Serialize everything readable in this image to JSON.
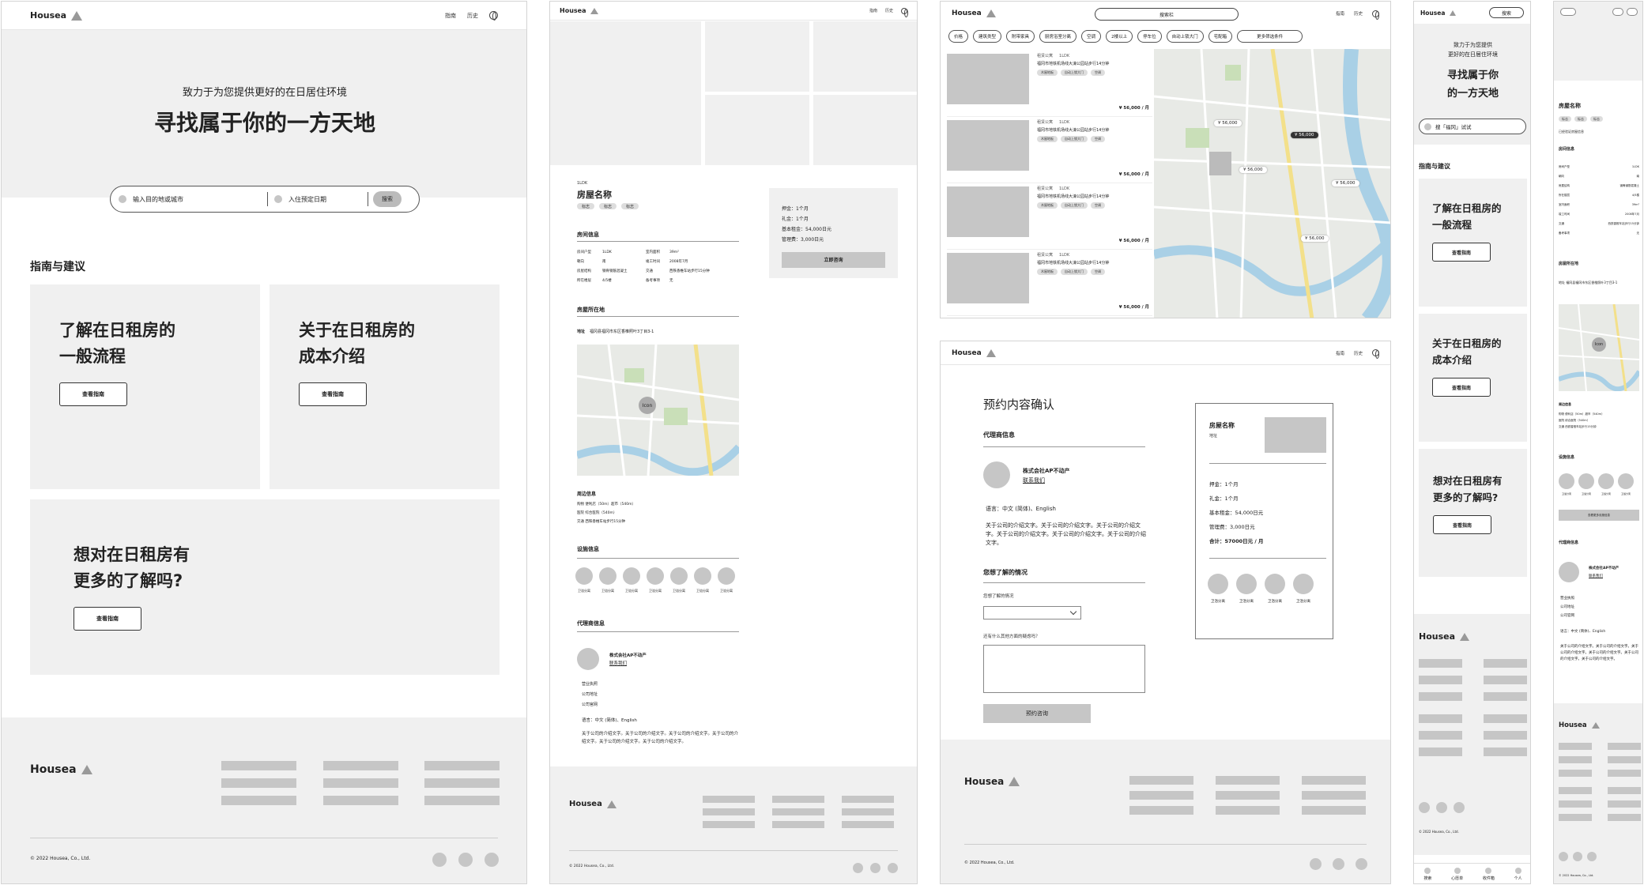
{
  "brand": "Housea",
  "nav": {
    "guide": "指南",
    "history": "历史"
  },
  "home": {
    "subtitle": "致力于为您提供更好的在日居住环境",
    "title": "寻找属于你的一方天地",
    "search_dest": "输入目的地或城市",
    "search_date": "入住预定日期",
    "search_btn": "搜索",
    "section": "指南与建议",
    "card1_l1": "了解在日租房的",
    "card1_l2": "一般流程",
    "card2_l1": "关于在日租房的",
    "card2_l2": "成本介绍",
    "card3_l1": "想对在日租房有",
    "card3_l2": "更多的了解吗?",
    "card_btn": "查看指南"
  },
  "copyright": "© 2022 Housea, Co., Ltd.",
  "detail": {
    "tag": "1LDK",
    "name": "房屋名称",
    "chip": "标志",
    "room_info": "房间信息",
    "rows": [
      [
        "房间户型",
        "1LDK",
        "室内面积",
        "39m²"
      ],
      [
        "朝向",
        "南",
        "竣工时间",
        "2008年7月"
      ],
      [
        "房屋结构",
        "钢骨钢筋混凝土",
        "交通",
        "西铁香椎车站步行15分钟"
      ],
      [
        "所在楼层",
        "4/5楼",
        "备考事项",
        "无"
      ]
    ],
    "location": "房屋所在地",
    "addr_label": "地址",
    "addr": "福冈县福冈市东区香椎照叶3丁目3-1",
    "map_icon": "Icon",
    "nearby": "周边信息",
    "nearby_rows": [
      "购物  便利店（50m）超市（540m）",
      "医院  综合医院（540m）",
      "交通  西铁香椎车站步行15分钟"
    ],
    "facilities": "设施信息",
    "fac_label": "卫浴分离",
    "agent_sec": "代理商信息",
    "agent": "株式会社AP不动产",
    "contact": "联系我们",
    "agent_items": [
      "营业执照",
      "公司地址",
      "公司官网"
    ],
    "lang": "语言：中文 (简体)、English",
    "intro": "关于公司的介绍文字。关于公司的介绍文字。关于公司的介绍文字。关于公司的介绍文字。关于公司的介绍文字。关于公司的介绍文字。",
    "price": [
      "押金：1个月",
      "礼金：1个月",
      "基本租金：54,000日元",
      "管理费：3,000日元"
    ],
    "consult_btn": "立即咨询"
  },
  "search": {
    "placeholder": "搜索栏",
    "filters": [
      "价格",
      "建筑类型",
      "附带家具",
      "厨房浴室分离",
      "空调",
      "2楼以上",
      "停车位",
      "自动上锁大门",
      "宅配箱",
      "更多筛选条件"
    ],
    "listing_type": "租赁公寓",
    "listing_layout": "1LDK",
    "listing_addr": "福冈市地铁机场线大濠公园站步行14分钟",
    "listing_tags": [
      "木屋地板",
      "自动上锁大门",
      "空调"
    ],
    "listing_price": "¥ 56,000 / 月",
    "pins": [
      "¥ 56,000",
      "¥ 56,000",
      "¥ 56,000",
      "¥ 56,000",
      "¥ 56,000"
    ]
  },
  "confirm": {
    "title": "预约内容确认",
    "agent_sec": "代理商信息",
    "want_sec": "您想了解的情况",
    "want_label": "您想了解的情况",
    "other_label": "还有什么其他方面的疑虑吗？",
    "submit": "预约咨询",
    "room": "房屋名称",
    "addr": "地址",
    "price": [
      "押金：1个月",
      "礼金：1个月",
      "基本租金：54,000日元",
      "管理费：3,000日元"
    ],
    "total": "合计：57000日元 / 月"
  },
  "mobile": {
    "search_btn": "搜索",
    "subtitle1": "致力于为您提供",
    "subtitle2": "更好的在日居住环境",
    "title1": "寻找属于你",
    "title2": "的一方天地",
    "search_ph": "搜「福冈」试试",
    "section": "指南与建议",
    "tabs": [
      "搜索",
      "心愿单",
      "收件箱",
      "个人"
    ]
  },
  "mdetail": {
    "room_info": "房间信息",
    "rows": [
      [
        "房间户型",
        "1LDK"
      ],
      [
        "朝向",
        "南"
      ],
      [
        "房屋结构",
        "钢骨钢筋混凝土"
      ],
      [
        "所在楼层",
        "4/5楼"
      ],
      [
        "室内面积",
        "39m²"
      ],
      [
        "竣工时间",
        "2008年7月"
      ],
      [
        "交通",
        "西铁香椎车站步行15分钟"
      ],
      [
        "备考事项",
        "无"
      ]
    ],
    "verified": "已经验证房屋信息",
    "location": "房屋所在地",
    "addr": "地址  福冈县福冈市东区香椎照叶3丁目3-1",
    "nearby": "周边信息",
    "nearby_rows": [
      "购物  便利店（50m）超市（540m）",
      "医院  综合医院（540m）",
      "交通  西铁香椎车站步行15分钟"
    ],
    "facilities": "设施信息",
    "more_btn": "查看更多设施信息",
    "agent_sec": "代理商信息",
    "items": [
      "营业执照",
      "公司地址",
      "公司官网"
    ]
  }
}
